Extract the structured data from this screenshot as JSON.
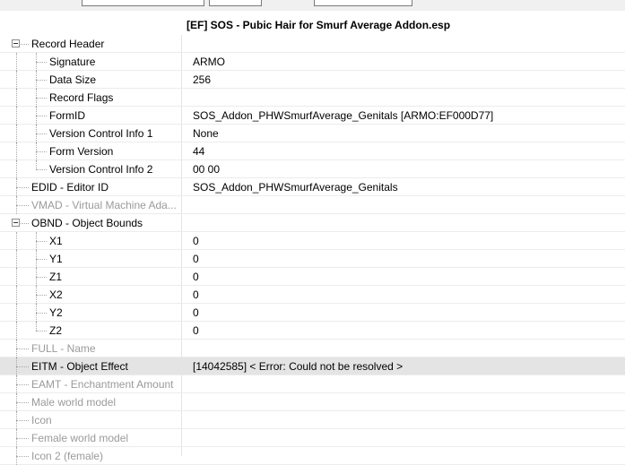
{
  "header": {
    "title": "[EF] SOS - Pubic Hair for Smurf Average Addon.esp"
  },
  "rows": [
    {
      "id": "record-header",
      "label": "Record Header",
      "value": "",
      "level": 0,
      "expanded": true,
      "disabled": false
    },
    {
      "id": "signature",
      "label": "Signature",
      "value": "ARMO",
      "level": 1,
      "disabled": false
    },
    {
      "id": "data-size",
      "label": "Data Size",
      "value": "256",
      "level": 1,
      "disabled": false
    },
    {
      "id": "record-flags",
      "label": "Record Flags",
      "value": "",
      "level": 1,
      "disabled": false
    },
    {
      "id": "formid",
      "label": "FormID",
      "value": "SOS_Addon_PHWSmurfAverage_Genitals [ARMO:EF000D77]",
      "level": 1,
      "disabled": false
    },
    {
      "id": "version-control-info-1",
      "label": "Version Control Info 1",
      "value": "None",
      "level": 1,
      "disabled": false
    },
    {
      "id": "form-version",
      "label": "Form Version",
      "value": "44",
      "level": 1,
      "disabled": false
    },
    {
      "id": "version-control-info-2",
      "label": "Version Control Info 2",
      "value": "00 00",
      "level": 1,
      "disabled": false
    },
    {
      "id": "edid",
      "label": "EDID - Editor ID",
      "value": "SOS_Addon_PHWSmurfAverage_Genitals",
      "level": 0,
      "disabled": false
    },
    {
      "id": "vmad",
      "label": "VMAD - Virtual Machine Ada...",
      "value": "",
      "level": 0,
      "disabled": true
    },
    {
      "id": "obnd",
      "label": "OBND - Object Bounds",
      "value": "",
      "level": 0,
      "expanded": true,
      "disabled": false
    },
    {
      "id": "x1",
      "label": "X1",
      "value": "0",
      "level": 1,
      "disabled": false
    },
    {
      "id": "y1",
      "label": "Y1",
      "value": "0",
      "level": 1,
      "disabled": false
    },
    {
      "id": "z1",
      "label": "Z1",
      "value": "0",
      "level": 1,
      "disabled": false
    },
    {
      "id": "x2",
      "label": "X2",
      "value": "0",
      "level": 1,
      "disabled": false
    },
    {
      "id": "y2",
      "label": "Y2",
      "value": "0",
      "level": 1,
      "disabled": false
    },
    {
      "id": "z2",
      "label": "Z2",
      "value": "0",
      "level": 1,
      "disabled": false
    },
    {
      "id": "full",
      "label": "FULL - Name",
      "value": "",
      "level": 0,
      "disabled": true
    },
    {
      "id": "eitm",
      "label": "EITM - Object Effect",
      "value": "[14042585] < Error: Could not be resolved >",
      "level": 0,
      "disabled": false,
      "selected": true
    },
    {
      "id": "eamt",
      "label": "EAMT - Enchantment Amount",
      "value": "",
      "level": 0,
      "disabled": true
    },
    {
      "id": "male-world-model",
      "label": "Male world model",
      "value": "",
      "level": 0,
      "disabled": true
    },
    {
      "id": "icon",
      "label": "Icon",
      "value": "",
      "level": 0,
      "disabled": true
    },
    {
      "id": "female-world-model",
      "label": "Female world model",
      "value": "",
      "level": 0,
      "disabled": true
    },
    {
      "id": "icon-2-female",
      "label": "Icon 2 (female)",
      "value": "",
      "level": 0,
      "disabled": true
    }
  ]
}
